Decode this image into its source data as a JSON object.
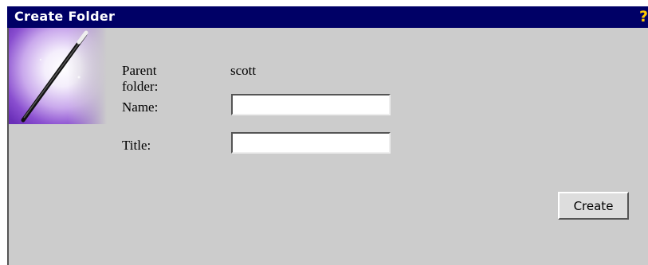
{
  "dialog": {
    "title": "Create Folder",
    "help_glyph": "?",
    "icons": {
      "help": "help-question-icon",
      "wizard": "magic-wand-icon"
    }
  },
  "form": {
    "parent_folder_label": "Parent folder:",
    "parent_folder_value": "scott",
    "name_label": "Name:",
    "name_value": "",
    "title_label": "Title:",
    "title_value": ""
  },
  "actions": {
    "create_label": "Create"
  },
  "colors": {
    "titlebar_bg": "#000066",
    "title_text": "#ffffff",
    "help_icon": "#ffcc00",
    "dialog_bg": "#cccccc"
  }
}
